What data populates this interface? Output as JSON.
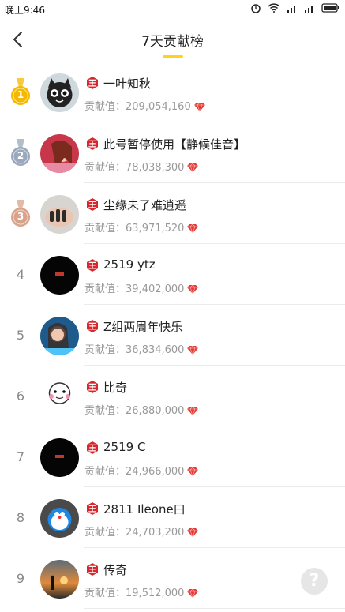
{
  "status_bar": {
    "time": "晚上9:46"
  },
  "header": {
    "title": "7天贡献榜"
  },
  "contribution_label": "贡献值：",
  "level_badge_text": "王",
  "help_label": "?",
  "colors": {
    "accent_underline": "#ffd21e",
    "badge_red": "#d8272d",
    "gem_red": "#e53935",
    "gold": "#f5b800",
    "silver": "#9aa8bb",
    "bronze": "#d9a28a"
  },
  "ranking": [
    {
      "rank": "1",
      "medal": "gold",
      "name": "一叶知秋",
      "value": "209,054,160",
      "avatar": "cat-avatar"
    },
    {
      "rank": "2",
      "medal": "silver",
      "name": "此号暂停使用【静候佳音】",
      "value": "78,038,300",
      "avatar": "girl-red-avatar"
    },
    {
      "rank": "3",
      "medal": "bronze",
      "name": "尘缘未了难逍遥",
      "value": "63,971,520",
      "avatar": "hands-avatar"
    },
    {
      "rank": "4",
      "medal": "",
      "name": "2519 ytz",
      "value": "39,402,000",
      "avatar": "black-logo-avatar"
    },
    {
      "rank": "5",
      "medal": "",
      "name": "Z组两周年快乐",
      "value": "36,834,600",
      "avatar": "blue-girl-avatar"
    },
    {
      "rank": "6",
      "medal": "",
      "name": "比奇",
      "value": "26,880,000",
      "avatar": "cartoon-face-avatar"
    },
    {
      "rank": "7",
      "medal": "",
      "name": "2519 C",
      "value": "24,966,000",
      "avatar": "black-logo-avatar"
    },
    {
      "rank": "8",
      "medal": "",
      "name": "2811 Ileone曰",
      "value": "24,703,200",
      "avatar": "doraemon-avatar"
    },
    {
      "rank": "9",
      "medal": "",
      "name": "传奇",
      "value": "19,512,000",
      "avatar": "sunset-avatar"
    }
  ]
}
